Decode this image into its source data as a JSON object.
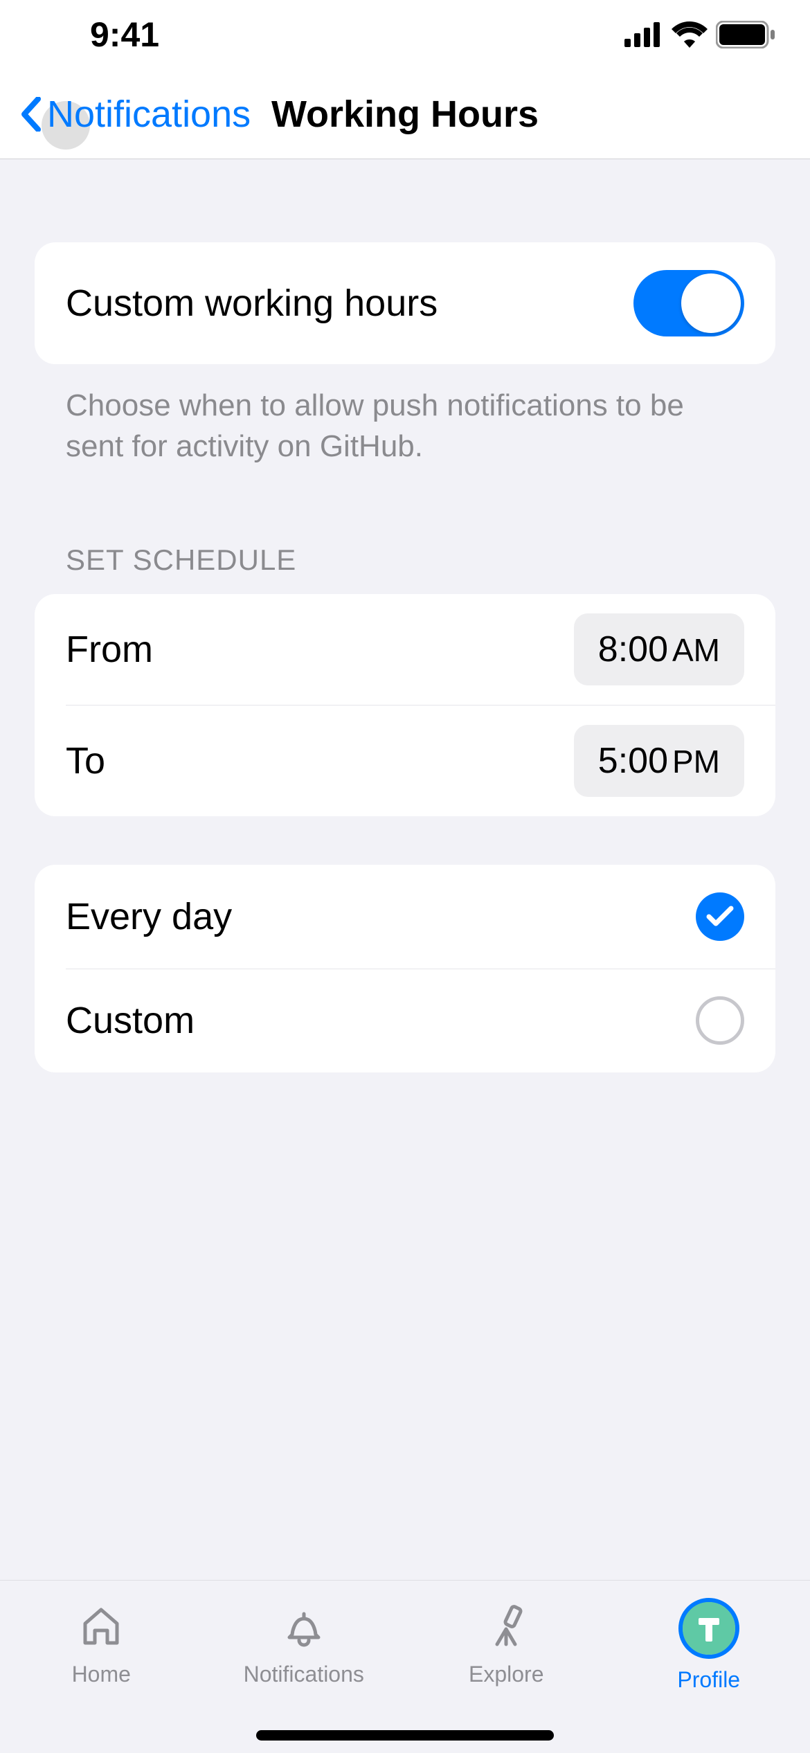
{
  "status": {
    "time": "9:41"
  },
  "nav": {
    "back_label": "Notifications",
    "title": "Working Hours"
  },
  "toggle": {
    "label": "Custom working hours",
    "on": true,
    "footer": "Choose when to allow push notifications to be sent for activity on GitHub."
  },
  "schedule": {
    "header": "SET SCHEDULE",
    "from_label": "From",
    "from_time": "8:00",
    "from_ampm": "AM",
    "to_label": "To",
    "to_time": "5:00",
    "to_ampm": "PM"
  },
  "days": {
    "everyday_label": "Every day",
    "custom_label": "Custom",
    "selected": "everyday"
  },
  "tabs": {
    "home": "Home",
    "notifications": "Notifications",
    "explore": "Explore",
    "profile": "Profile"
  }
}
